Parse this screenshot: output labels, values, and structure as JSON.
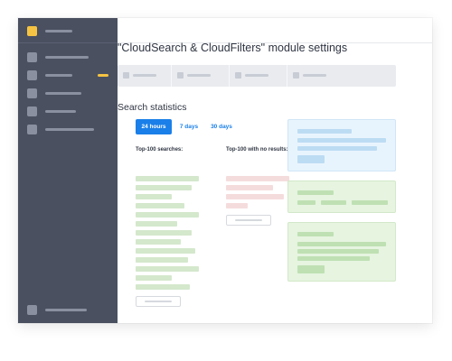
{
  "app": {
    "page_title": "\"CloudSearch & CloudFilters\" module settings"
  },
  "sidebar": {
    "items": [
      {
        "name": "nav-item-1",
        "badge": false
      },
      {
        "name": "nav-item-2",
        "badge": true
      },
      {
        "name": "nav-item-3",
        "badge": false
      },
      {
        "name": "nav-item-4",
        "badge": false
      },
      {
        "name": "nav-item-5",
        "badge": false
      }
    ],
    "footer_item": "nav-item-settings"
  },
  "tabs": [
    "tab-1",
    "tab-2",
    "tab-3",
    "tab-4"
  ],
  "stats": {
    "title": "Search statistics",
    "periods": [
      {
        "label": "24 hours",
        "active": true
      },
      {
        "label": "7 days",
        "active": false
      },
      {
        "label": "30 days",
        "active": false
      }
    ],
    "top_searches_heading": "Top-100 searches:",
    "no_results_heading": "Top-100 with no results:"
  },
  "colors": {
    "sidebar": "#4a5060",
    "accent": "#1a7fe8",
    "badge": "#f6c342",
    "logo": "#f6c342",
    "success_panel": "#e6f4e0",
    "info_panel": "#e8f4fd",
    "row_success": "#d4e8cc",
    "row_error": "#f5dcdc"
  }
}
